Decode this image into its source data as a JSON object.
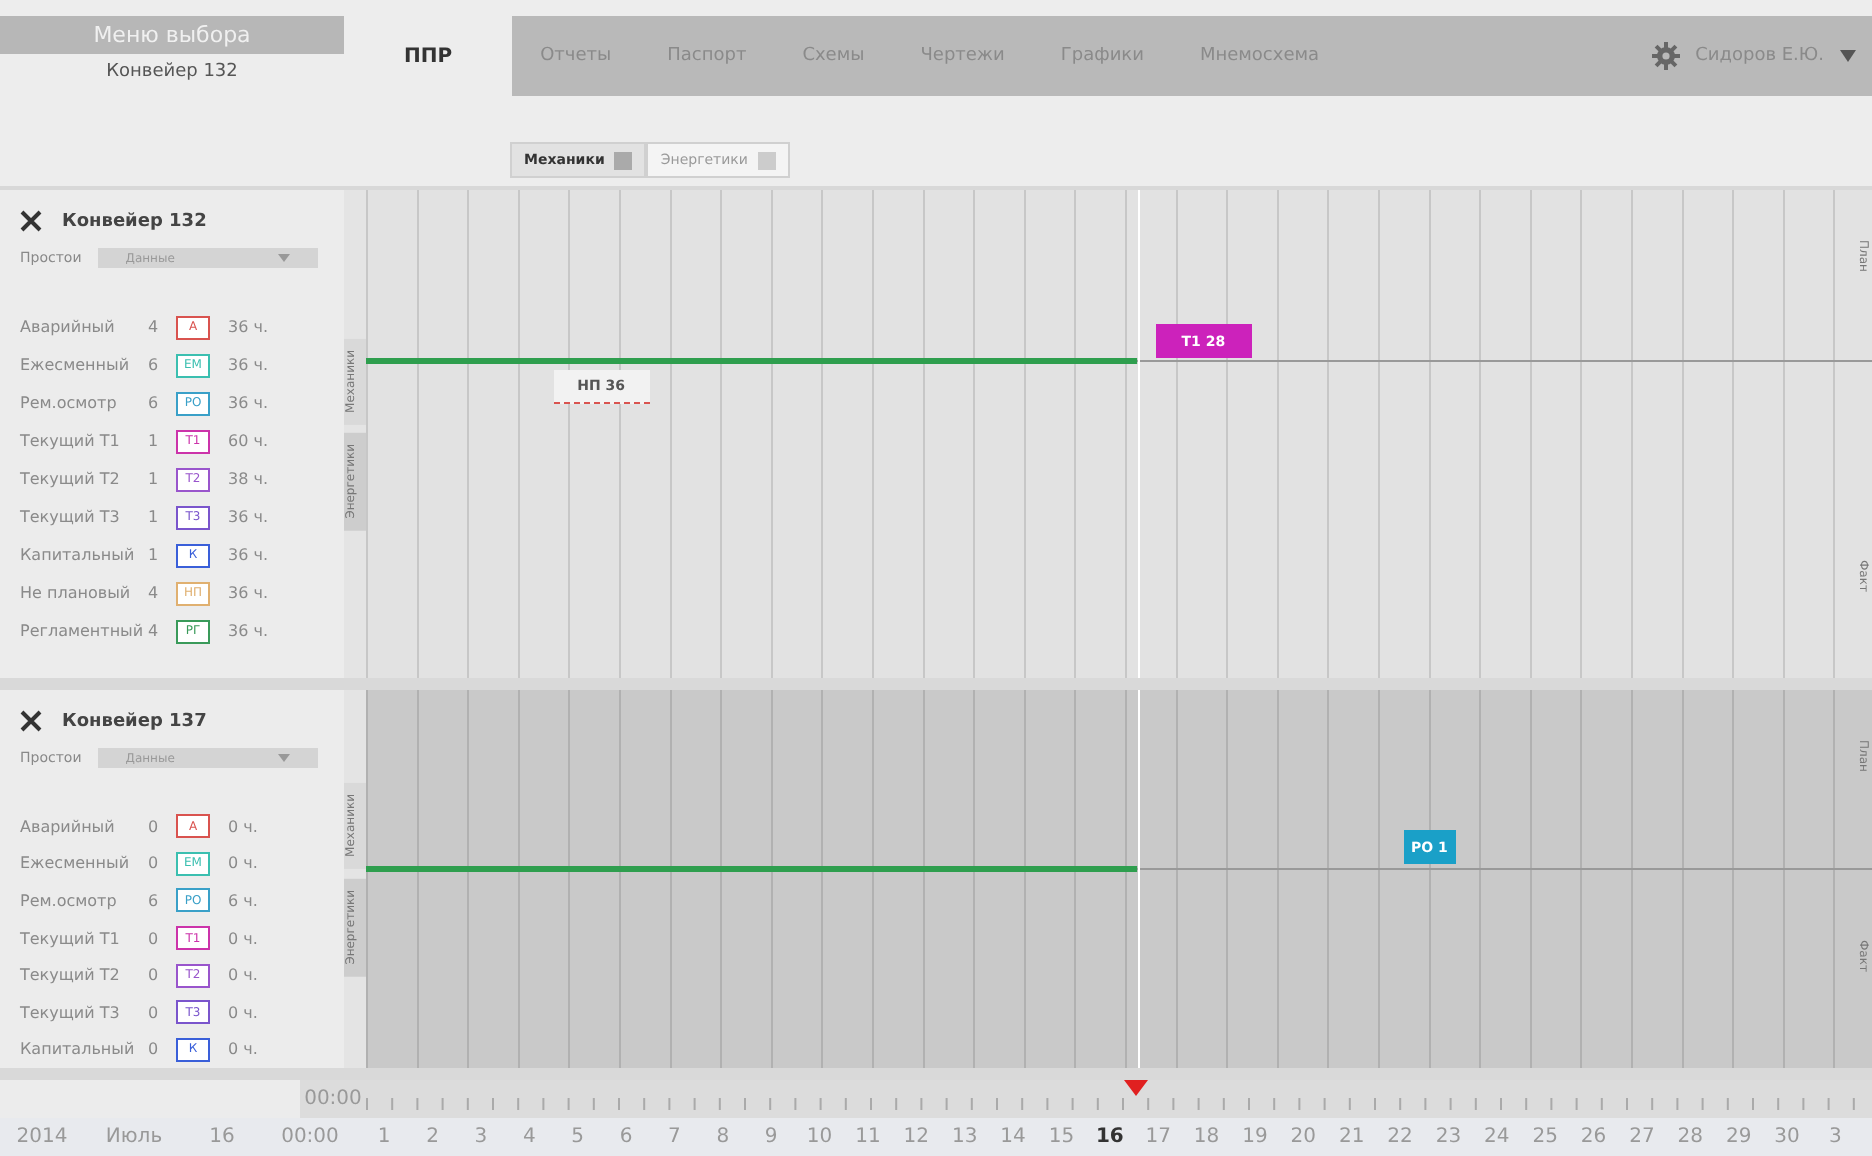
{
  "menu": {
    "title": "Меню выбора",
    "subtitle": "Конвейер 132"
  },
  "tabs": [
    {
      "label": "ППР",
      "selected": true
    },
    {
      "label": "Отчеты",
      "selected": false
    },
    {
      "label": "Паспорт",
      "selected": false
    },
    {
      "label": "Схемы",
      "selected": false
    },
    {
      "label": "Чертежи",
      "selected": false
    },
    {
      "label": "Графики",
      "selected": false
    },
    {
      "label": "Мнемосхема",
      "selected": false
    }
  ],
  "user": "Сидоров Е.Ю.",
  "subtabs": [
    {
      "label": "Механики",
      "selected": true
    },
    {
      "label": "Энергетики",
      "selected": false
    }
  ],
  "panels": [
    {
      "title": "Конвейер 132",
      "filter_label": "Простои",
      "filter_value": "Данные",
      "shaded": false,
      "side_tabs": [
        "Механики",
        "Энергетики"
      ],
      "lane_labels": [
        "План",
        "Факт"
      ],
      "legend": [
        {
          "name": "Аварийный",
          "count": "4",
          "code": "А",
          "hours": "36 ч.",
          "color": "#d9534f"
        },
        {
          "name": "Ежесменный",
          "count": "6",
          "code": "ЕМ",
          "hours": "36 ч.",
          "color": "#3bbfb0"
        },
        {
          "name": "Рем.осмотр",
          "count": "6",
          "code": "РО",
          "hours": "36 ч.",
          "color": "#3aa0c8"
        },
        {
          "name": "Текущий Т1",
          "count": "1",
          "code": "Т1",
          "hours": "60 ч.",
          "color": "#cc33aa"
        },
        {
          "name": "Текущий Т2",
          "count": "1",
          "code": "Т2",
          "hours": "38 ч.",
          "color": "#9955cc"
        },
        {
          "name": "Текущий Т3",
          "count": "1",
          "code": "Т3",
          "hours": "36 ч.",
          "color": "#7a55cc"
        },
        {
          "name": "Капитальный",
          "count": "1",
          "code": "К",
          "hours": "36 ч.",
          "color": "#3a5fd9"
        },
        {
          "name": "Не плановый",
          "count": "4",
          "code": "НП",
          "hours": "36 ч.",
          "color": "#e0b070"
        },
        {
          "name": "Регламентный",
          "count": "4",
          "code": "РГ",
          "hours": "36 ч.",
          "color": "#3a9a5a"
        }
      ],
      "events": [
        {
          "label": "Т1 28",
          "kind": "filled",
          "color": "#cc22bb"
        },
        {
          "label": "НП 36",
          "kind": "outlined",
          "color": "#d9534f"
        }
      ]
    },
    {
      "title": "Конвейер 137",
      "filter_label": "Простои",
      "filter_value": "Данные",
      "shaded": true,
      "side_tabs": [
        "Механики",
        "Энергетики"
      ],
      "lane_labels": [
        "План",
        "Факт"
      ],
      "legend": [
        {
          "name": "Аварийный",
          "count": "0",
          "code": "А",
          "hours": "0 ч.",
          "color": "#d9534f"
        },
        {
          "name": "Ежесменный",
          "count": "0",
          "code": "ЕМ",
          "hours": "0 ч.",
          "color": "#3bbfb0"
        },
        {
          "name": "Рем.осмотр",
          "count": "6",
          "code": "РО",
          "hours": "6 ч.",
          "color": "#3aa0c8"
        },
        {
          "name": "Текущий Т1",
          "count": "0",
          "code": "Т1",
          "hours": "0 ч.",
          "color": "#cc33aa"
        },
        {
          "name": "Текущий Т2",
          "count": "0",
          "code": "Т2",
          "hours": "0 ч.",
          "color": "#9955cc"
        },
        {
          "name": "Текущий Т3",
          "count": "0",
          "code": "Т3",
          "hours": "0 ч.",
          "color": "#7a55cc"
        },
        {
          "name": "Капитальный",
          "count": "0",
          "code": "К",
          "hours": "0 ч.",
          "color": "#3a5fd9"
        }
      ],
      "events": [
        {
          "label": "РО 1",
          "kind": "filled",
          "color": "#1aa0c8"
        }
      ]
    }
  ],
  "timeline": {
    "time_top": "00:00",
    "year": "2014",
    "month": "Июль",
    "day": "16",
    "time": "00:00",
    "days": [
      {
        "label": "1",
        "selected": false
      },
      {
        "label": "2",
        "selected": false
      },
      {
        "label": "3",
        "selected": false
      },
      {
        "label": "4",
        "selected": false
      },
      {
        "label": "5",
        "selected": false
      },
      {
        "label": "6",
        "selected": false
      },
      {
        "label": "7",
        "selected": false
      },
      {
        "label": "8",
        "selected": false
      },
      {
        "label": "9",
        "selected": false
      },
      {
        "label": "10",
        "selected": false
      },
      {
        "label": "11",
        "selected": false
      },
      {
        "label": "12",
        "selected": false
      },
      {
        "label": "13",
        "selected": false
      },
      {
        "label": "14",
        "selected": false
      },
      {
        "label": "15",
        "selected": false
      },
      {
        "label": "16",
        "selected": true
      },
      {
        "label": "17",
        "selected": false
      },
      {
        "label": "18",
        "selected": false
      },
      {
        "label": "19",
        "selected": false
      },
      {
        "label": "20",
        "selected": false
      },
      {
        "label": "21",
        "selected": false
      },
      {
        "label": "22",
        "selected": false
      },
      {
        "label": "23",
        "selected": false
      },
      {
        "label": "24",
        "selected": false
      },
      {
        "label": "25",
        "selected": false
      },
      {
        "label": "26",
        "selected": false
      },
      {
        "label": "27",
        "selected": false
      },
      {
        "label": "28",
        "selected": false
      },
      {
        "label": "29",
        "selected": false
      },
      {
        "label": "30",
        "selected": false
      },
      {
        "label": "3",
        "selected": false
      }
    ]
  }
}
